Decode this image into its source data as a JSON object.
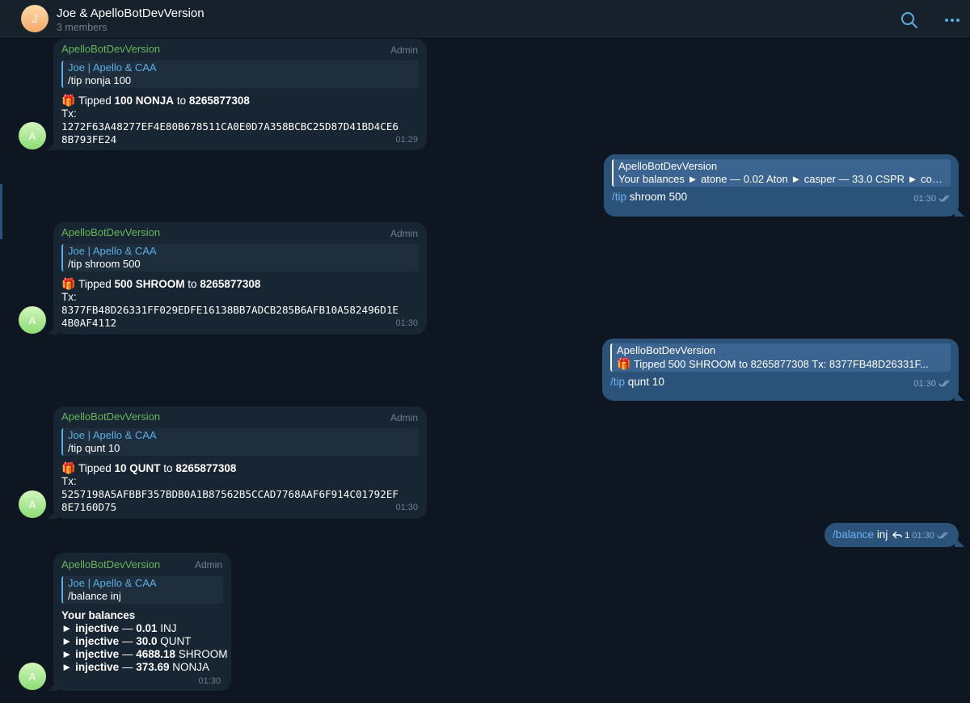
{
  "header": {
    "avatar_letter": "J",
    "title": "Joe & ApelloBotDevVersion",
    "subtitle": "3 members",
    "icons": [
      "search-icon",
      "more-icon"
    ]
  },
  "colors": {
    "background": "#0e1621",
    "incoming_bubble": "#182533",
    "outgoing_bubble": "#2b5278",
    "sender_name": "#67b65a",
    "link_blue": "#6ab3f3"
  },
  "bot_avatar_letter": "A",
  "admin_label": "Admin",
  "messages": [
    {
      "sender": "ApelloBotDevVersion",
      "quote_name": "Joe | Apello & CAA",
      "quote_text": "/tip nonja 100",
      "tipped_prefix": "Tipped",
      "amount": "100 NONJA",
      "to_word": "to",
      "recipient": "8265877308",
      "tx_label": "Tx:",
      "tx_line1": "1272F63A48277EF4E80B678511CA0E0D7A358BCBC25D87D41BD4CE6",
      "tx_line2": "8B793FE24",
      "time": "01:29"
    },
    {
      "sender": "ApelloBotDevVersion",
      "quote_name": "Joe | Apello & CAA",
      "quote_text": "/tip shroom 500",
      "tipped_prefix": "Tipped",
      "amount": "500 SHROOM",
      "to_word": "to",
      "recipient": "8265877308",
      "tx_label": "Tx:",
      "tx_line1": "8377FB48D26331FF029EDFE16138BB7ADCB285B6AFB10A582496D1E",
      "tx_line2": "4B0AF4112",
      "time": "01:30"
    },
    {
      "sender": "ApelloBotDevVersion",
      "quote_name": "Joe | Apello & CAA",
      "quote_text": "/tip qunt 10",
      "tipped_prefix": "Tipped",
      "amount": "10 QUNT",
      "to_word": "to",
      "recipient": "8265877308",
      "tx_label": "Tx:",
      "tx_line1": "5257198A5AFBBF357BDB0A1B87562B5CCAD7768AAF6F914C01792EF",
      "tx_line2": "8E7160D75",
      "time": "01:30"
    }
  ],
  "balance_message": {
    "sender": "ApelloBotDevVersion",
    "quote_name": "Joe | Apello & CAA",
    "quote_text": "/balance inj",
    "heading": "Your balances",
    "rows": [
      {
        "arrow": "►",
        "chain": "injective",
        "dash": "—",
        "amount": "0.01",
        "token": "INJ"
      },
      {
        "arrow": "►",
        "chain": "injective",
        "dash": "—",
        "amount": "30.0",
        "token": "QUNT"
      },
      {
        "arrow": "►",
        "chain": "injective",
        "dash": "—",
        "amount": "4688.18",
        "token": "SHROOM"
      },
      {
        "arrow": "►",
        "chain": "injective",
        "dash": "—",
        "amount": "373.69",
        "token": "NONJA"
      }
    ],
    "time": "01:30"
  },
  "outgoing": [
    {
      "quote_name": "ApelloBotDevVersion",
      "quote_text": "Your balances ► atone — 0.02 Aton ► casper — 33.0 CSPR ► cos...",
      "command": "/tip",
      "args": "shroom 500",
      "time": "01:30"
    },
    {
      "quote_name": "ApelloBotDevVersion",
      "quote_text": "Tipped 500 SHROOM to 8265877308 Tx: 8377FB48D26331F...",
      "command": "/tip",
      "args": "qunt 10",
      "time": "01:30"
    },
    {
      "command": "/balance",
      "args": "inj",
      "reply_count": "1",
      "time": "01:30"
    }
  ]
}
